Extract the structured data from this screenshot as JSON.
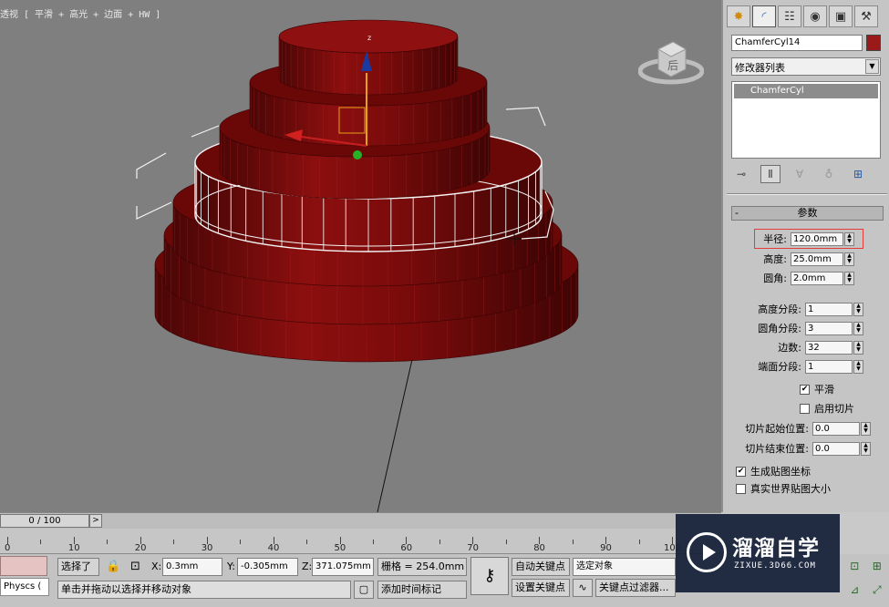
{
  "viewport": {
    "label": "透视 [ 平滑 + 高光 + 边面 + HW ]",
    "viewcube_face": "后",
    "axis_z": "z"
  },
  "command_panel": {
    "tabs": [
      "create-icon",
      "modify-icon",
      "hierarchy-icon",
      "motion-icon",
      "display-icon",
      "utilities-icon"
    ],
    "object_name": "ChamferCyl14",
    "object_color": "#9a1a1a",
    "modifier_list": "修改器列表",
    "stack_items": [
      "ChamferCyl"
    ],
    "rollout_title": "参数",
    "rollout_toggle": "-",
    "params": {
      "radius_label": "半径:",
      "radius": "120.0mm",
      "height_label": "高度:",
      "height": "25.0mm",
      "fillet_label": "圆角:",
      "fillet": "2.0mm",
      "height_segs_label": "高度分段:",
      "height_segs": "1",
      "fillet_segs_label": "圆角分段:",
      "fillet_segs": "3",
      "sides_label": "边数:",
      "sides": "32",
      "cap_segs_label": "端面分段:",
      "cap_segs": "1",
      "smooth_label": "平滑",
      "smooth_checked": true,
      "slice_on_label": "启用切片",
      "slice_on_checked": false,
      "slice_from_label": "切片起始位置:",
      "slice_from": "0.0",
      "slice_to_label": "切片结束位置:",
      "slice_to": "0.0",
      "gen_map_label": "生成贴图坐标",
      "gen_map_checked": true,
      "real_world_label": "真实世界贴图大小",
      "real_world_checked": false
    }
  },
  "timeline": {
    "frame": "0 / 100",
    "next": ">",
    "ticks": [
      "0",
      "10",
      "20",
      "30",
      "40",
      "50",
      "60",
      "70",
      "80",
      "90",
      "100"
    ]
  },
  "status_bar": {
    "maxscript": "Physcs (",
    "selected": "选择了",
    "x_label": "X:",
    "x_value": "0.3mm",
    "y_label": "Y:",
    "y_value": "-0.305mm",
    "z_label": "Z:",
    "z_value": "371.075mm",
    "grid": "栅格 = 254.0mm",
    "prompt": "单击并拖动以选择并移动对象",
    "add_time_tag": "添加时间标记",
    "auto_key": "自动关键点",
    "set_key": "设置关键点",
    "selection_set": "选定对象",
    "key_filters": "关键点过滤器..."
  },
  "watermark": {
    "title": "溜溜自学",
    "url": "ZIXUE.3D66.COM"
  }
}
